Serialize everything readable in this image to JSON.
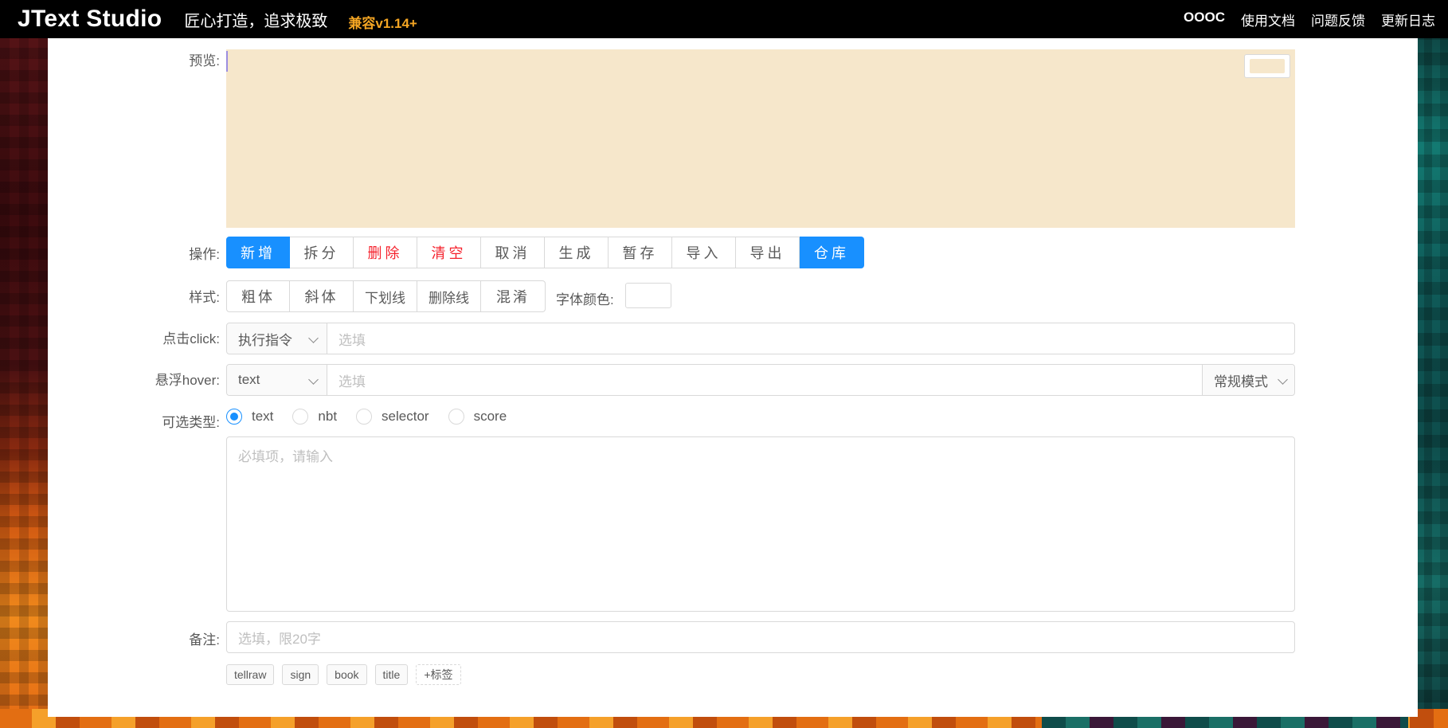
{
  "header": {
    "brand": "JText Studio",
    "slogan": "匠心打造，追求极致",
    "compat": "兼容v1.14+",
    "links": [
      "OOOC",
      "使用文档",
      "问题反馈",
      "更新日志"
    ]
  },
  "preview": {
    "label": "预览:"
  },
  "operations": {
    "label": "操作:",
    "buttons": [
      "新增",
      "拆分",
      "删除",
      "清空",
      "取消",
      "生成",
      "暂存",
      "导入",
      "导出",
      "仓库"
    ]
  },
  "styles": {
    "label": "样式:",
    "buttons": [
      "粗体",
      "斜体",
      "下划线",
      "删除线",
      "混淆"
    ],
    "font_color_label": "字体颜色:"
  },
  "click": {
    "label": "点击click:",
    "action": "执行指令",
    "placeholder": "选填"
  },
  "hover": {
    "label": "悬浮hover:",
    "type": "text",
    "placeholder": "选填",
    "mode": "常规模式"
  },
  "types": {
    "label": "可选类型:",
    "options": [
      "text",
      "nbt",
      "selector",
      "score"
    ],
    "selected": "text"
  },
  "content": {
    "placeholder": "必填项，请输入"
  },
  "note": {
    "label": "备注:",
    "placeholder": "选填，限20字"
  },
  "tags": [
    "tellraw",
    "sign",
    "book",
    "title"
  ],
  "add_tag": "+标签",
  "colors": {
    "primary": "#1890ff",
    "danger": "#f5222d",
    "accent": "#f5a623",
    "preview_bg": "#f6e7cb"
  }
}
